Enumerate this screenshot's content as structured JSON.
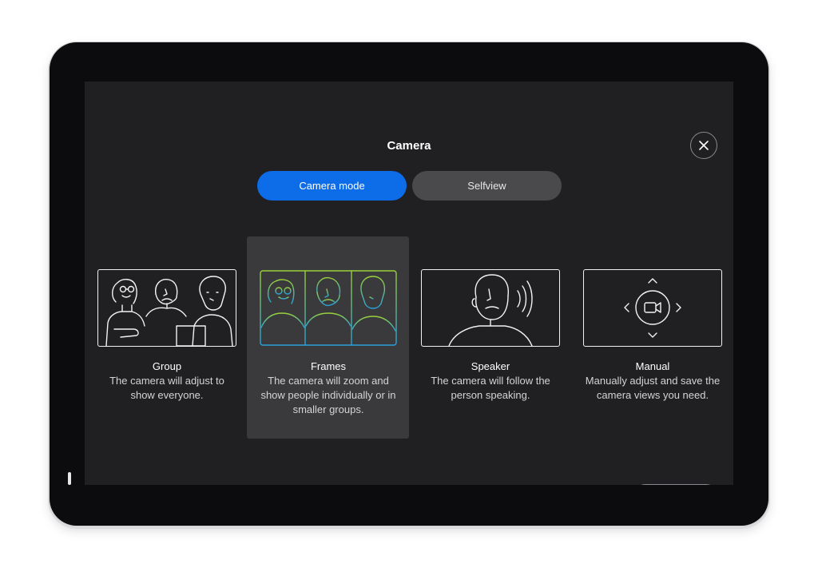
{
  "dialog": {
    "title": "Camera",
    "close_icon": "close-icon"
  },
  "tabs": [
    {
      "label": "Camera mode",
      "active": true
    },
    {
      "label": "Selfview",
      "active": false
    }
  ],
  "modes": [
    {
      "label": "Group",
      "description": "The camera will adjust to show everyone.",
      "icon": "group-illustration",
      "selected": false
    },
    {
      "label": "Frames",
      "description": "The camera will zoom and show people individually or in smaller groups.",
      "icon": "frames-illustration",
      "selected": true
    },
    {
      "label": "Speaker",
      "description": "The camera will follow the person speaking.",
      "icon": "speaker-illustration",
      "selected": false
    },
    {
      "label": "Manual",
      "description": "Manually adjust and save the camera views you need.",
      "icon": "manual-illustration",
      "selected": false
    }
  ],
  "volume": {
    "down_icon": "volume-down-icon",
    "up_icon": "volume-up-icon"
  },
  "colors": {
    "accent": "#0d6ce8",
    "screen_bg": "#202022",
    "selected_card": "#3a3a3d",
    "frames_gradient": [
      "#9ad03a",
      "#2a9fd8"
    ]
  }
}
